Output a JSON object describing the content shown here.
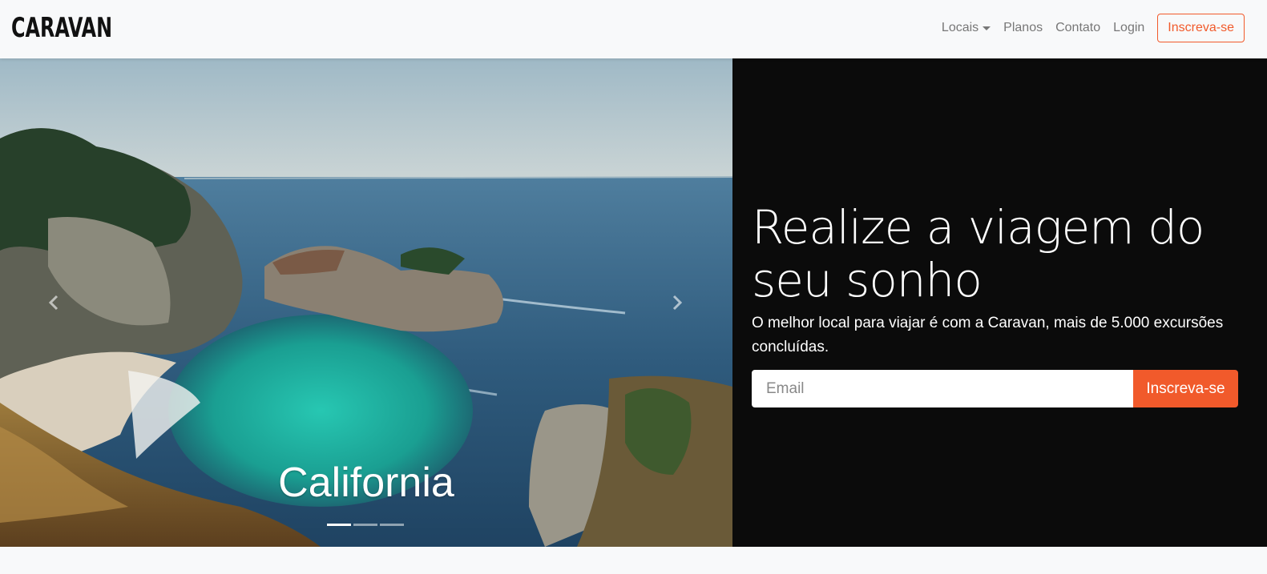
{
  "brand": "CARAVAN",
  "nav": {
    "locais": "Locais",
    "planos": "Planos",
    "contato": "Contato",
    "login": "Login",
    "cta": "Inscreva-se"
  },
  "carousel": {
    "caption": "California",
    "slide_count": 3,
    "active_index": 0
  },
  "hero": {
    "headline": "Realize a viagem do seu sonho",
    "subtext": "O melhor local para viajar é com a Caravan, mais de 5.000 excursões concluídas.",
    "email_placeholder": "Email",
    "submit_label": "Inscreva-se"
  },
  "colors": {
    "accent": "#f15a2b",
    "dark_panel": "#0b0b0b",
    "navbar_bg": "#f8f9fa"
  },
  "icons": {
    "prev": "chevron-left-icon",
    "next": "chevron-right-icon",
    "dropdown": "caret-down-icon"
  }
}
